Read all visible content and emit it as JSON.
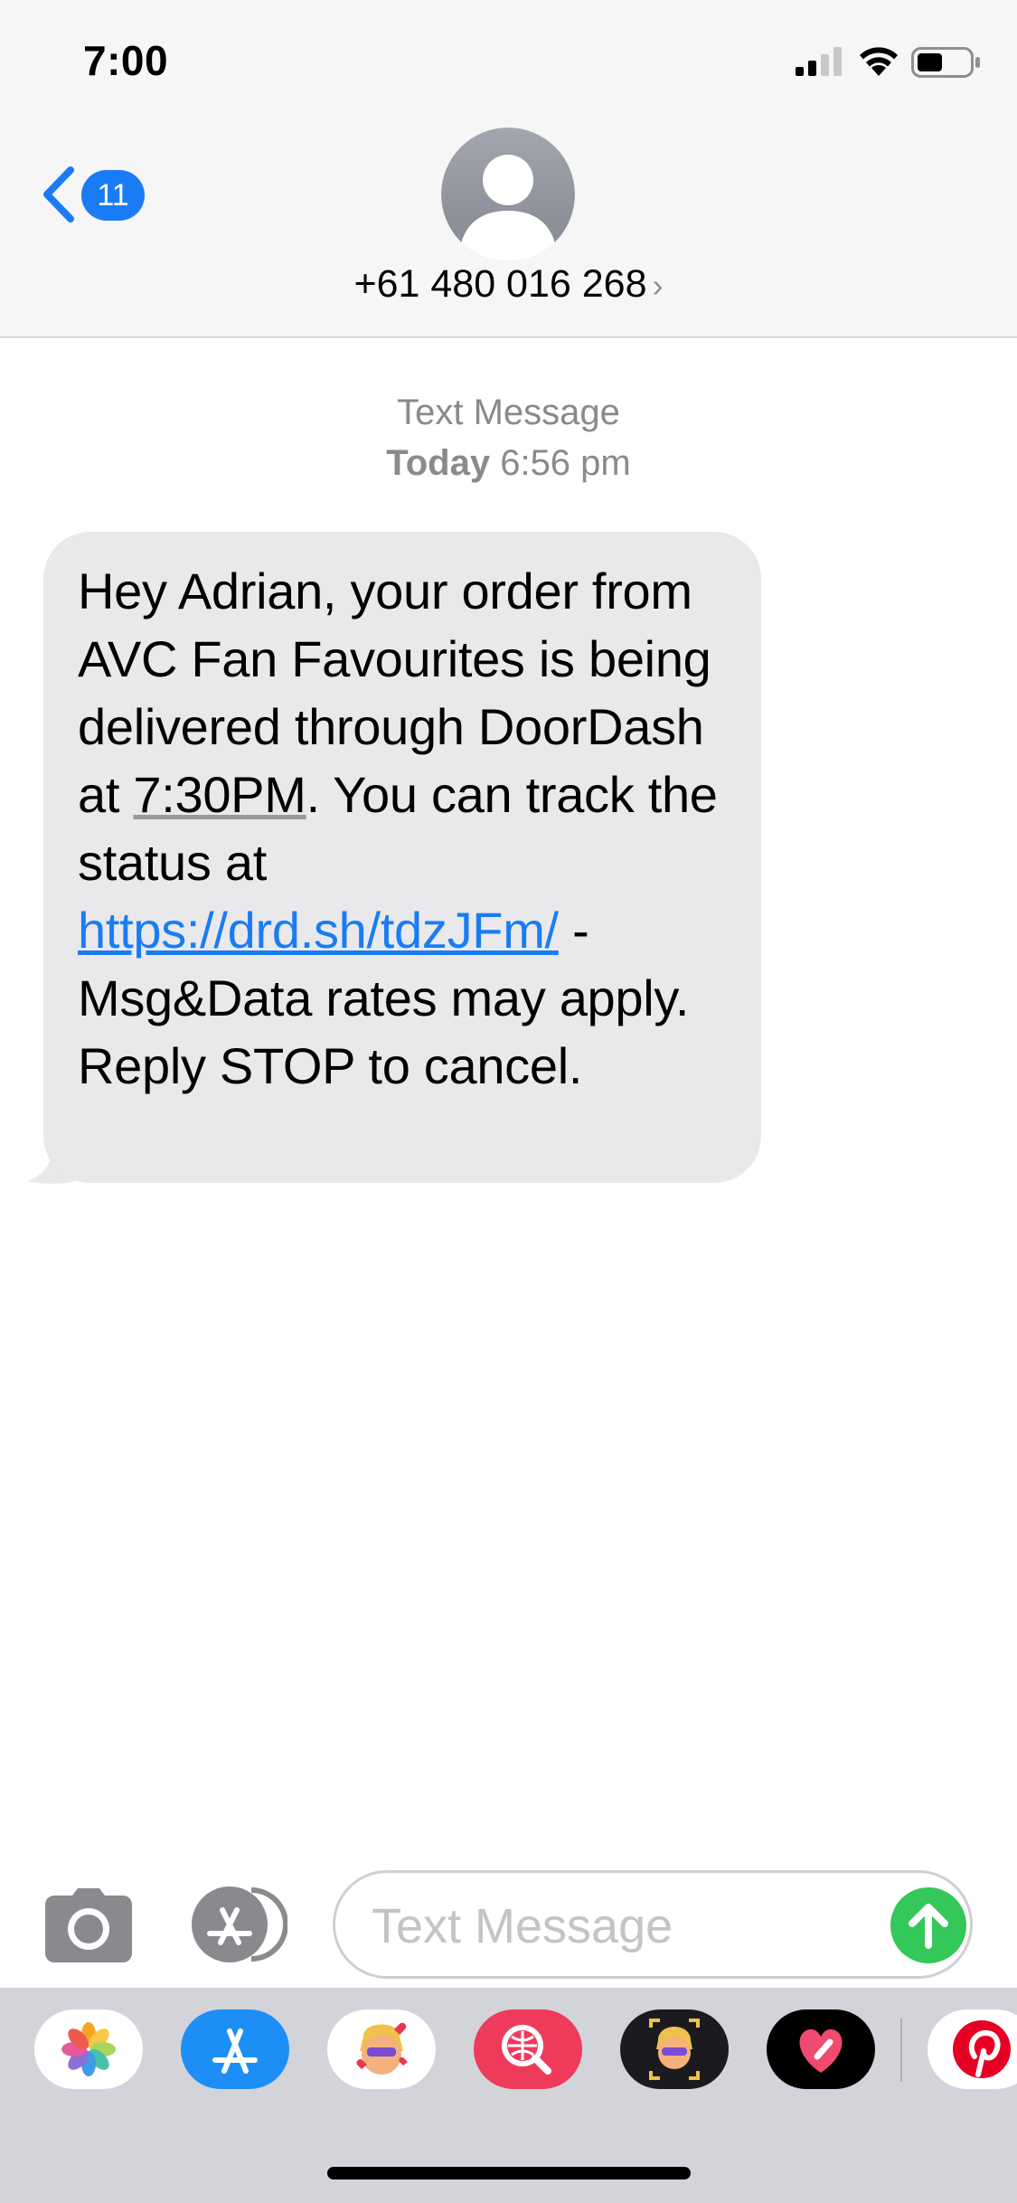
{
  "status_bar": {
    "time": "7:00"
  },
  "header": {
    "back_badge_count": "11",
    "contact_name": "+61 480 016 268",
    "contact_chevron": "›"
  },
  "conversation": {
    "service_label": "Text Message",
    "date_day": "Today",
    "date_time": "6:56 pm",
    "message": {
      "text_1": "Hey Adrian, your order from AVC Fan Favourites is being delivered through DoorDash at ",
      "time_link": "7:30PM",
      "text_2": ". You can track the status at ",
      "url_link": "https://drd.sh/tdzJFm/",
      "text_3": " - Msg&Data rates may apply. Reply STOP to cancel."
    }
  },
  "input_bar": {
    "placeholder": "Text Message",
    "value": ""
  },
  "app_drawer": {
    "apps": [
      {
        "name": "photos-icon"
      },
      {
        "name": "app-store-icon"
      },
      {
        "name": "memoji-stickers-icon"
      },
      {
        "name": "images-search-icon"
      },
      {
        "name": "memoji-camera-icon"
      },
      {
        "name": "digital-touch-icon"
      },
      {
        "name": "pinterest-icon"
      }
    ]
  },
  "colors": {
    "accent_blue": "#1a7cf5",
    "send_green": "#34c759",
    "bubble_gray": "#e9e9eb",
    "header_bg": "#f6f6f6",
    "drawer_bg": "#d3d4d9"
  }
}
